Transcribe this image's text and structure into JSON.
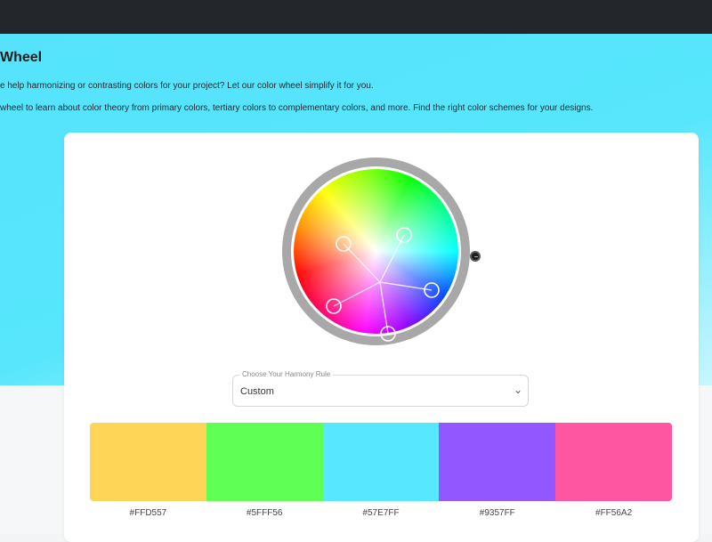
{
  "page": {
    "title": "Wheel",
    "intro_1": "e help harmonizing or contrasting colors for your project? Let our color wheel simplify it for you.",
    "intro_2": "wheel to learn about color theory from primary colors, tertiary colors to complementary colors, and more. Find the right color schemes for your designs."
  },
  "harmony": {
    "label": "Choose Your Harmony Rule",
    "value": "Custom",
    "icon": "chevron-down-icon"
  },
  "palette": [
    {
      "hex": "#FFD557",
      "color": "#FFD557"
    },
    {
      "hex": "#5FFF56",
      "color": "#5FFF56"
    },
    {
      "hex": "#57E7FF",
      "color": "#57E7FF"
    },
    {
      "hex": "#9357FF",
      "color": "#9357FF"
    },
    {
      "hex": "#FF56A2",
      "color": "#FF56A2"
    }
  ],
  "wheel": {
    "center_color": "#ffffff",
    "ring_color": "#a8a8a8"
  }
}
